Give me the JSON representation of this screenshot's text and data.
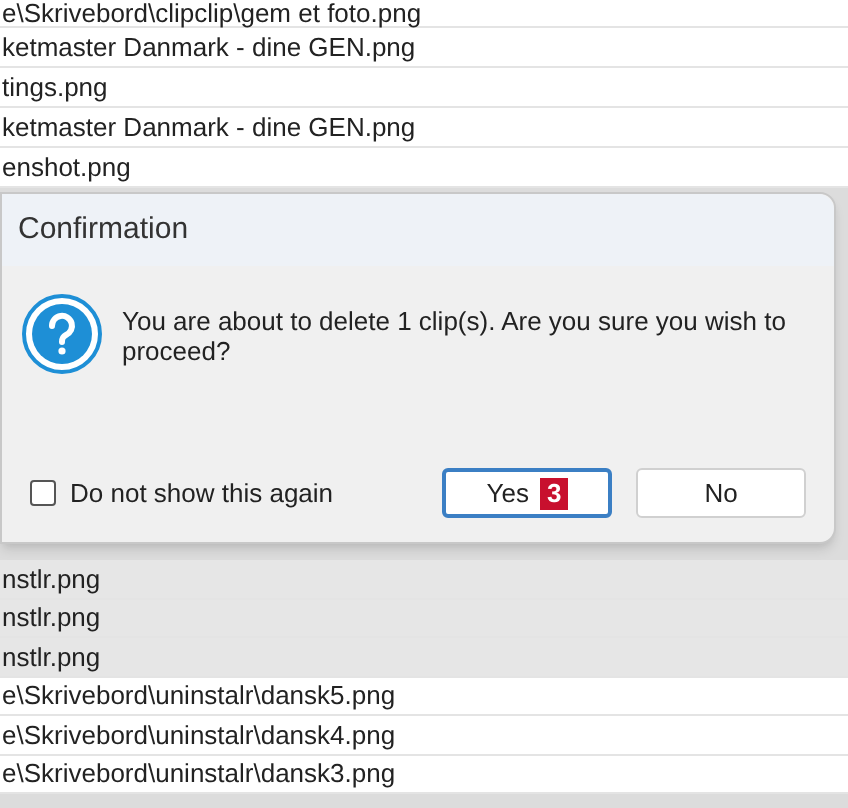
{
  "files_above": [
    "e\\Skrivebord\\clipclip\\gem et foto.png",
    "ketmaster Danmark - dine GEN.png",
    "tings.png",
    "ketmaster Danmark - dine GEN.png",
    "enshot.png"
  ],
  "dialog": {
    "title": "Confirmation",
    "message": "You are about to delete 1 clip(s). Are you sure you wish to proceed?",
    "checkbox": {
      "label": "Do not show this again",
      "checked": false
    },
    "buttons": [
      {
        "label": "Yes",
        "default": true,
        "badge": "3"
      },
      {
        "label": "No",
        "default": false
      }
    ]
  },
  "files_below": [
    "nstlr.png",
    "nstlr.png",
    "nstlr.png",
    "e\\Skrivebord\\uninstalr\\dansk5.png",
    "e\\Skrivebord\\uninstalr\\dansk4.png",
    "e\\Skrivebord\\uninstalr\\dansk3.png"
  ]
}
